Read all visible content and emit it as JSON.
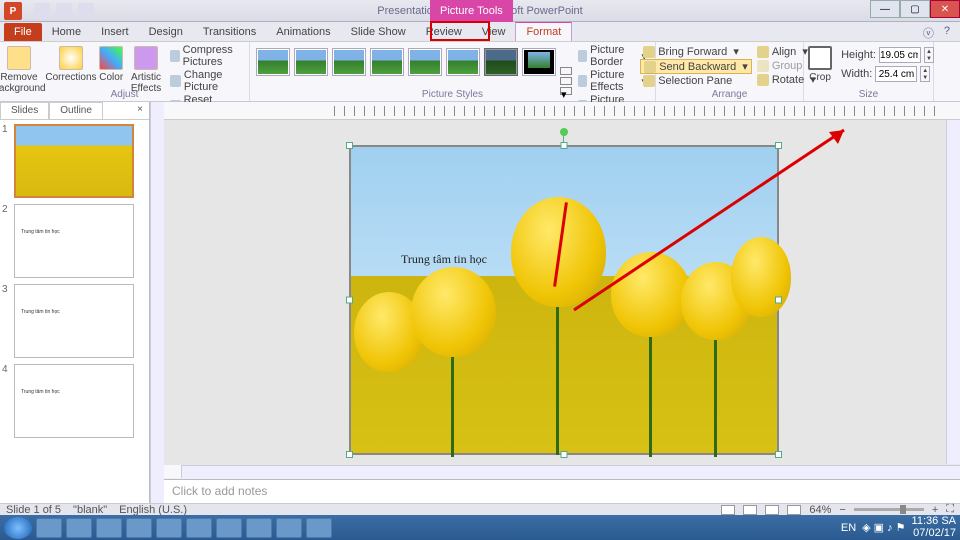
{
  "titlebar": {
    "doc_title": "Presentation1.pptx - Microsoft PowerPoint",
    "context_tab": "Picture Tools"
  },
  "tabs": {
    "file": "File",
    "items": [
      "Home",
      "Insert",
      "Design",
      "Transitions",
      "Animations",
      "Slide Show",
      "Review",
      "View",
      "Format"
    ],
    "active": "Format"
  },
  "ribbon": {
    "adjust": {
      "remove_bg": "Remove Background",
      "corrections": "Corrections",
      "color": "Color",
      "artistic": "Artistic Effects",
      "compress": "Compress Pictures",
      "change": "Change Picture",
      "reset": "Reset Picture",
      "label": "Adjust"
    },
    "styles": {
      "label": "Picture Styles",
      "border": "Picture Border",
      "effects": "Picture Effects",
      "layout": "Picture Layout"
    },
    "arrange": {
      "forward": "Bring Forward",
      "backward": "Send Backward",
      "selection": "Selection Pane",
      "align": "Align",
      "group": "Group",
      "rotate": "Rotate",
      "label": "Arrange"
    },
    "size": {
      "crop": "Crop",
      "height_label": "Height:",
      "width_label": "Width:",
      "height": "19.05 cm",
      "width": "25.4 cm",
      "label": "Size"
    }
  },
  "panes": {
    "slides_tab": "Slides",
    "outline_tab": "Outline",
    "slides": [
      {
        "num": "1",
        "thumb_text": ""
      },
      {
        "num": "2",
        "thumb_text": "Trung tâm tin học"
      },
      {
        "num": "3",
        "thumb_text": "Trung tâm tin học"
      },
      {
        "num": "4",
        "thumb_text": "Trung tâm tin học"
      }
    ]
  },
  "canvas": {
    "caption": "Trung tâm tin học"
  },
  "notes": {
    "placeholder": "Click to add notes"
  },
  "status": {
    "slide_info": "Slide 1 of 5",
    "theme": "\"blank\"",
    "lang": "English (U.S.)",
    "zoom": "64%"
  },
  "taskbar": {
    "lang": "EN",
    "time": "11:36 SA",
    "date": "07/02/17"
  }
}
